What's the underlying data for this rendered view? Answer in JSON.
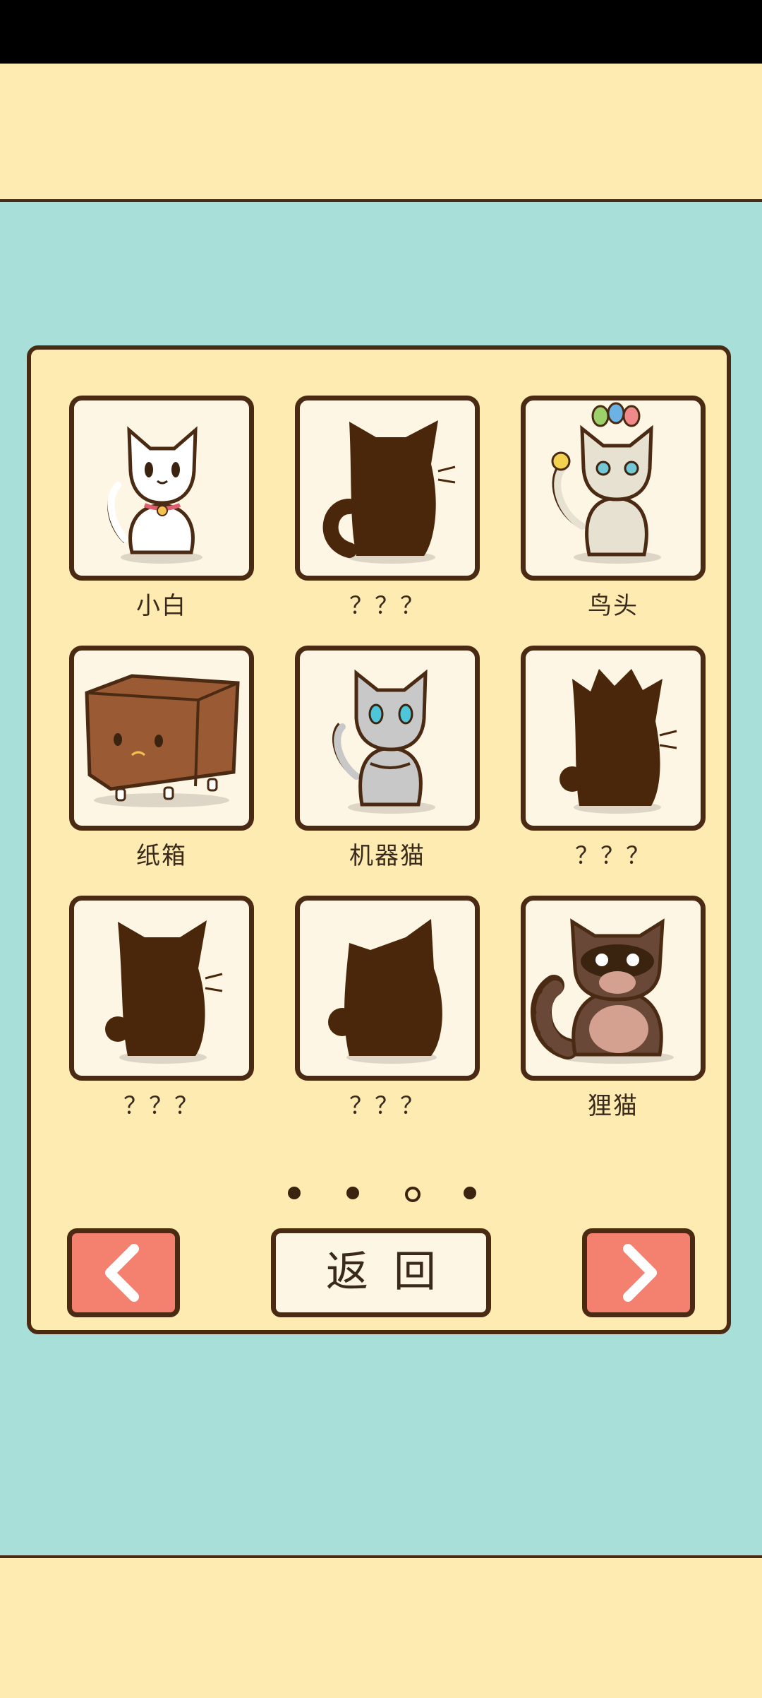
{
  "cats": [
    {
      "name": "小白",
      "unlocked": true,
      "icon": "white-cat"
    },
    {
      "name": "？？？",
      "unlocked": false,
      "icon": "cat-silhouette"
    },
    {
      "name": "鸟头",
      "unlocked": true,
      "icon": "bird-head-cat"
    },
    {
      "name": "纸箱",
      "unlocked": true,
      "icon": "box-cat"
    },
    {
      "name": "机器猫",
      "unlocked": true,
      "icon": "robot-cat"
    },
    {
      "name": "？？？",
      "unlocked": false,
      "icon": "cat-silhouette"
    },
    {
      "name": "？？？",
      "unlocked": false,
      "icon": "cat-silhouette"
    },
    {
      "name": "？？？",
      "unlocked": false,
      "icon": "cat-silhouette"
    },
    {
      "name": "狸猫",
      "unlocked": true,
      "icon": "raccoon-dog"
    }
  ],
  "pagination": {
    "total": 4,
    "current": 3
  },
  "buttons": {
    "back_label": "返回",
    "prev_icon": "chevron-left-icon",
    "next_icon": "chevron-right-icon"
  },
  "colors": {
    "accent": "#f4806f",
    "panel": "#fdebb1",
    "background": "#a8dfd9",
    "outline": "#4a2a12"
  }
}
